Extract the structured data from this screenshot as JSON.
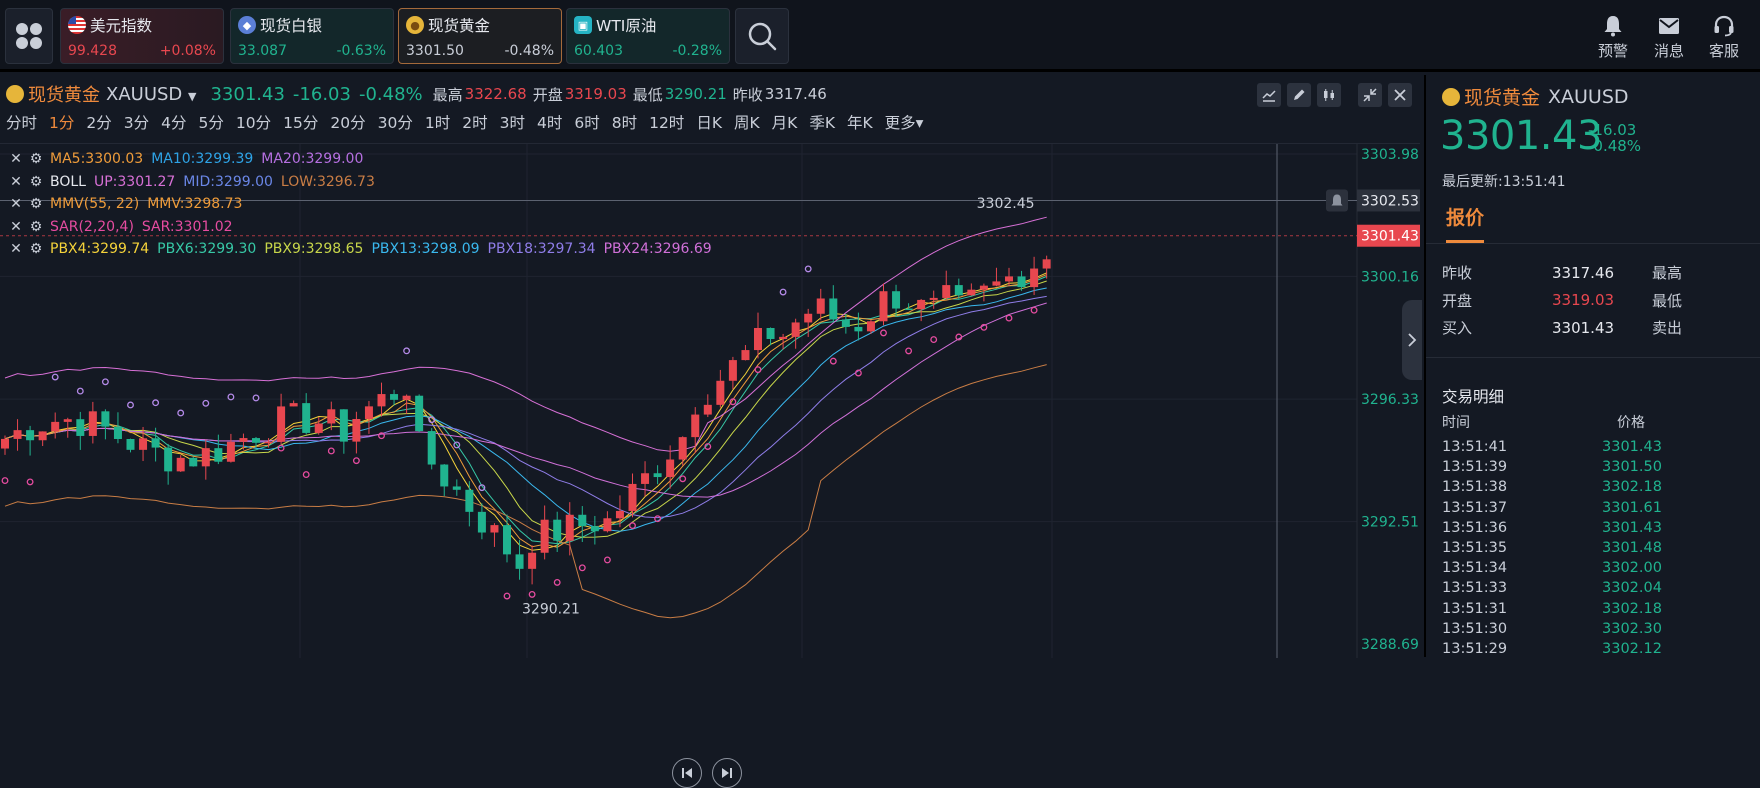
{
  "tickers": [
    {
      "name": "美元指数",
      "price": "99.428",
      "change": "+0.08%",
      "price_color": "#e8474f",
      "change_color": "#e8474f",
      "icon": "us-flag-icon"
    },
    {
      "name": "现货白银",
      "price": "33.087",
      "change": "-0.63%",
      "price_color": "#20b38f",
      "change_color": "#20b38f",
      "icon": "silver-icon"
    },
    {
      "name": "现货黄金",
      "price": "3301.50",
      "change": "-0.48%",
      "price_color": "#c9ced8",
      "change_color": "#c9ced8",
      "icon": "gold-icon"
    },
    {
      "name": "WTI原油",
      "price": "60.403",
      "change": "-0.28%",
      "price_color": "#20b38f",
      "change_color": "#20b38f",
      "icon": "oil-icon"
    }
  ],
  "top_actions": {
    "alert": "预警",
    "message": "消息",
    "service": "客服"
  },
  "header": {
    "name": "现货黄金",
    "code": "XAUUSD",
    "price": "3301.43",
    "change": "-16.03",
    "change_pct": "-0.48%",
    "high_label": "最高",
    "high": "3322.68",
    "open_label": "开盘",
    "open": "3319.03",
    "low_label": "最低",
    "low": "3290.21",
    "prev_label": "昨收",
    "prev": "3317.46"
  },
  "periods": [
    "分时",
    "1分",
    "2分",
    "3分",
    "4分",
    "5分",
    "10分",
    "15分",
    "20分",
    "30分",
    "1时",
    "2时",
    "3时",
    "4时",
    "6时",
    "8时",
    "12时",
    "日K",
    "周K",
    "月K",
    "季K",
    "年K",
    "更多▾"
  ],
  "active_period": "1分",
  "indicators": {
    "ma": {
      "ma5": "MA5:3300.03",
      "ma10": "MA10:3299.39",
      "ma20": "MA20:3299.00"
    },
    "boll": {
      "name": "BOLL",
      "up": "UP:3301.27",
      "mid": "MID:3299.00",
      "low": "LOW:3296.73"
    },
    "mmv": {
      "name": "MMV(55, 22)",
      "value": "MMV:3298.73"
    },
    "sar": {
      "name": "SAR(2,20,4)",
      "value": "SAR:3301.02"
    },
    "pbx": {
      "p4": "PBX4:3299.74",
      "p6": "PBX6:3299.30",
      "p9": "PBX9:3298.65",
      "p13": "PBX13:3298.09",
      "p18": "PBX18:3297.34",
      "p24": "PBX24:3296.69"
    }
  },
  "axis": {
    "ticks": [
      "3303.98",
      "3300.16",
      "3296.33",
      "3292.51",
      "3288.69"
    ],
    "crosshair_price": "3302.53",
    "last_price": "3301.43",
    "high_mark": "3302.45",
    "low_mark": "3290.21"
  },
  "colors": {
    "up": "#e8474f",
    "down": "#20b38f",
    "accent": "#ef8a3c",
    "bg": "#141923"
  },
  "panel": {
    "name": "现货黄金",
    "code": "XAUUSD",
    "price": "3301.43",
    "change": "-16.03",
    "change_pct": "-0.48%",
    "updated": "最后更新:13:51:41",
    "tab": "报价",
    "quote": [
      {
        "k": "昨收",
        "v": "3317.46",
        "color": "#e6e8ee",
        "k2": "最高"
      },
      {
        "k": "开盘",
        "v": "3319.03",
        "color": "#e8474f",
        "k2": "最低"
      },
      {
        "k": "买入",
        "v": "3301.43",
        "color": "#e6e8ee",
        "k2": "卖出"
      }
    ],
    "trades_title": "交易明细",
    "trades_head": {
      "time": "时间",
      "price": "价格"
    },
    "trades": [
      {
        "t": "13:51:41",
        "p": "3301.43"
      },
      {
        "t": "13:51:39",
        "p": "3301.50"
      },
      {
        "t": "13:51:38",
        "p": "3302.18"
      },
      {
        "t": "13:51:37",
        "p": "3301.61"
      },
      {
        "t": "13:51:36",
        "p": "3301.43"
      },
      {
        "t": "13:51:35",
        "p": "3301.48"
      },
      {
        "t": "13:51:34",
        "p": "3302.00"
      },
      {
        "t": "13:51:33",
        "p": "3302.04"
      },
      {
        "t": "13:51:31",
        "p": "3302.18"
      },
      {
        "t": "13:51:30",
        "p": "3302.30"
      },
      {
        "t": "13:51:29",
        "p": "3302.12"
      }
    ]
  }
}
